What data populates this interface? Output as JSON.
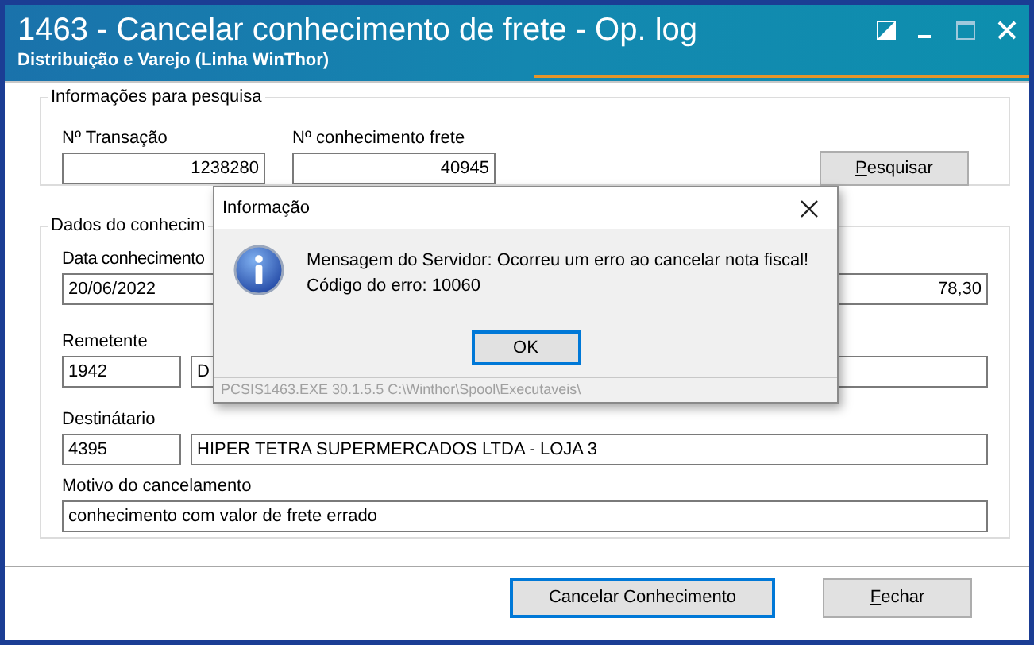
{
  "window": {
    "title": "1463 - Cancelar conhecimento de frete - Op. log",
    "subtitle": "Distribuição e Varejo (Linha WinThor)"
  },
  "search_group": {
    "title": "Informações para pesquisa",
    "fields": [
      {
        "label": "Nº Transação",
        "value": "1238280"
      },
      {
        "label": "Nº conhecimento frete",
        "value": "40945"
      }
    ],
    "button": {
      "label": "Pesquisar",
      "underlined_letter": true
    }
  },
  "data_group": {
    "title": "Dados do conhecim",
    "date": {
      "label": "Data conhecimento",
      "value": "20/06/2022"
    },
    "amount": {
      "value": "78,30"
    },
    "sender": {
      "label": "Remetente",
      "code": "1942",
      "name": "D"
    },
    "recipient": {
      "label": "Destinátario",
      "code": "4395",
      "name": "HIPER TETRA SUPERMERCADOS LTDA - LOJA 3"
    },
    "reason": {
      "label": "Motivo do cancelamento",
      "value": "conhecimento com valor de frete errado"
    }
  },
  "footer_buttons": [
    {
      "label": "Cancelar Conhecimento",
      "focused": true,
      "underlined_letter": false
    },
    {
      "label": "Fechar",
      "focused": false,
      "underlined_letter": true
    }
  ],
  "dialog": {
    "title": "Informação",
    "message_lines": [
      "Mensagem do Servidor: Ocorreu um erro ao cancelar nota fiscal!",
      "Código do erro: 10060"
    ],
    "button": {
      "label": "OK",
      "focused": true
    },
    "status": "PCSIS1463.EXE 30.1.5.5 C:\\Winthor\\Spool\\Executaveis\\"
  }
}
